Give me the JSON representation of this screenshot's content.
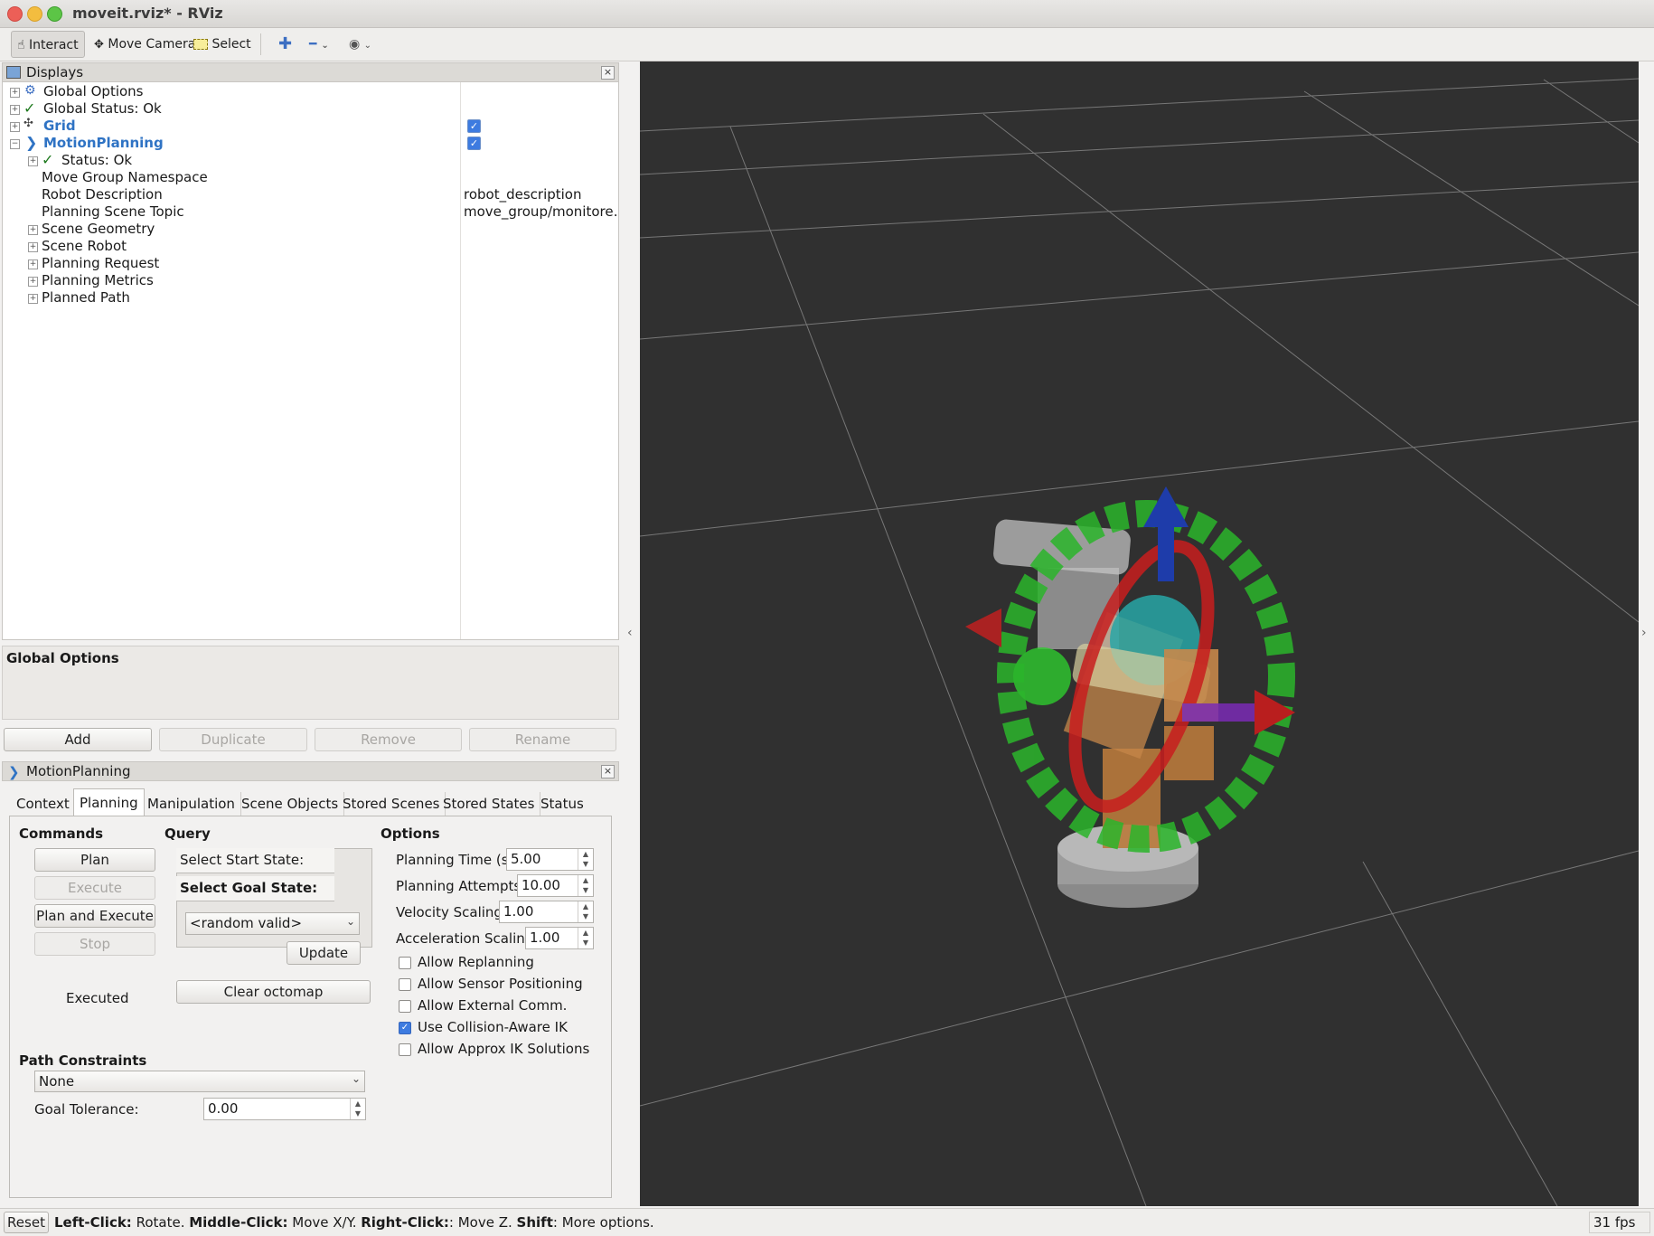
{
  "window": {
    "title": "moveit.rviz* - RViz"
  },
  "toolbar": {
    "interact": "Interact",
    "move_camera": "Move Camera",
    "select": "Select"
  },
  "displays": {
    "header": "Displays",
    "items": [
      {
        "label": "Global Options"
      },
      {
        "label": "Global Status: Ok"
      },
      {
        "label": "Grid"
      },
      {
        "label": "MotionPlanning"
      },
      {
        "label": "Status: Ok"
      },
      {
        "label": "Move Group Namespace"
      },
      {
        "label": "Robot Description",
        "value": "robot_description"
      },
      {
        "label": "Planning Scene Topic",
        "value": "move_group/monitore…"
      },
      {
        "label": "Scene Geometry"
      },
      {
        "label": "Scene Robot"
      },
      {
        "label": "Planning Request"
      },
      {
        "label": "Planning Metrics"
      },
      {
        "label": "Planned Path"
      }
    ],
    "description_title": "Global Options",
    "buttons": {
      "add": "Add",
      "duplicate": "Duplicate",
      "remove": "Remove",
      "rename": "Rename"
    }
  },
  "motion": {
    "header": "MotionPlanning",
    "tabs": [
      "Context",
      "Planning",
      "Manipulation",
      "Scene Objects",
      "Stored Scenes",
      "Stored States",
      "Status"
    ],
    "commands": {
      "title": "Commands",
      "plan": "Plan",
      "execute": "Execute",
      "plan_execute": "Plan and Execute",
      "stop": "Stop",
      "status": "Executed"
    },
    "query": {
      "title": "Query",
      "start_state": "Select Start State:",
      "goal_state": "Select Goal State:",
      "goal_select": "<random valid>",
      "update": "Update",
      "clear": "Clear octomap"
    },
    "options": {
      "title": "Options",
      "planning_time_label": "Planning Time (s):",
      "planning_time": "5.00",
      "attempts_label": "Planning Attempts:",
      "attempts": "10.00",
      "velocity_label": "Velocity Scaling:",
      "velocity": "1.00",
      "accel_label": "Acceleration Scaling:",
      "accel": "1.00",
      "allow_replanning": "Allow Replanning",
      "allow_sensor": "Allow Sensor Positioning",
      "allow_external": "Allow External Comm.",
      "collision_ik": "Use Collision-Aware IK",
      "approx_ik": "Allow Approx IK Solutions"
    },
    "path": {
      "title": "Path Constraints",
      "constraint": "None",
      "tolerance_label": "Goal Tolerance:",
      "tolerance": "0.00"
    }
  },
  "status_bar": {
    "reset": "Reset",
    "left_click": "Left-Click:",
    "rotate": " Rotate. ",
    "middle_click": "Middle-Click:",
    "move_xy": " Move X/Y. ",
    "right_click": "Right-Click:",
    "move_z": ": Move Z. ",
    "shift": "Shift",
    "more": ": More options.",
    "fps": "31 fps"
  }
}
